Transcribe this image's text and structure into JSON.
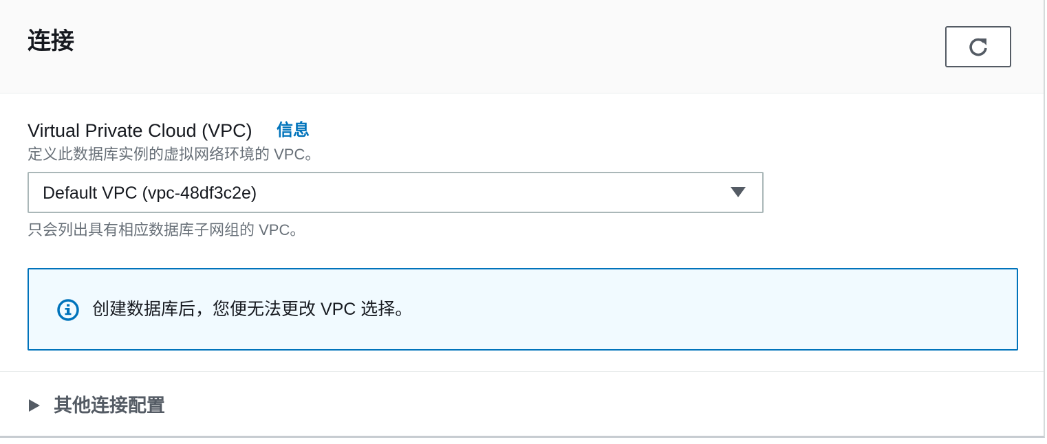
{
  "header": {
    "title": "连接",
    "refresh_icon": "refresh-icon"
  },
  "vpc_field": {
    "label": "Virtual Private Cloud (VPC)",
    "info_link": "信息",
    "description": "定义此数据库实例的虚拟网络环境的 VPC。",
    "selected_value": "Default VPC (vpc-48df3c2e)",
    "hint": "只会列出具有相应数据库子网组的 VPC。"
  },
  "alert": {
    "icon": "info-icon",
    "text": "创建数据库后，您便无法更改 VPC 选择。",
    "color": "#0073bb"
  },
  "expander": {
    "label": "其他连接配置",
    "expanded": false
  }
}
